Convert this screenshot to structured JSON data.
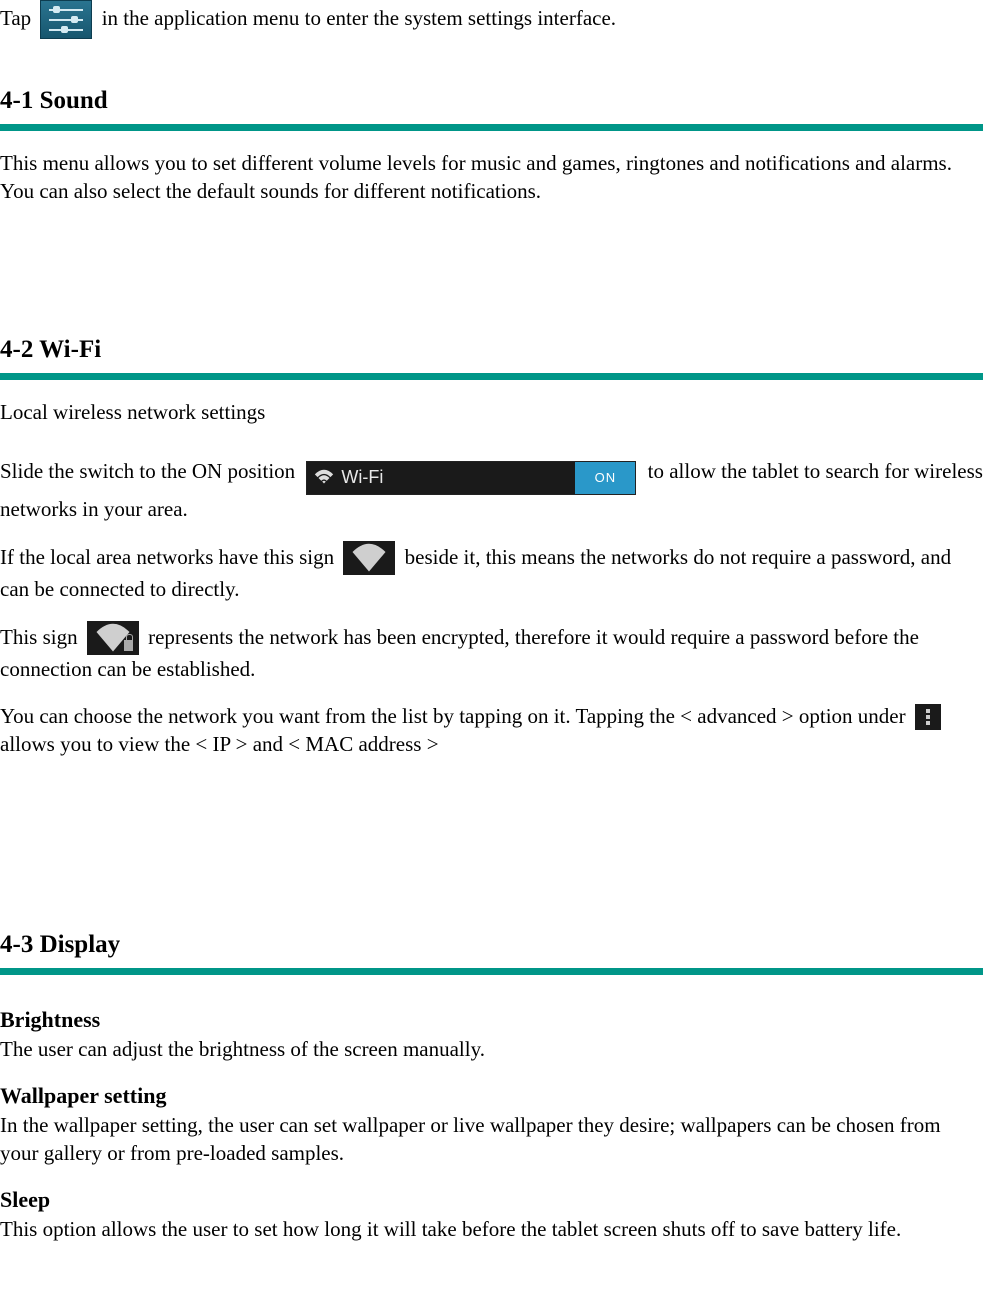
{
  "intro": {
    "before": "Tap",
    "after": "in the application menu to enter the system settings interface."
  },
  "sound": {
    "heading": "4-1 Sound",
    "body": "This menu allows you to set different volume levels for music and games, ringtones and notifications and alarms.    You can also select the default sounds for different notifications."
  },
  "wifi": {
    "heading": "4-2 Wi-Fi",
    "subtitle": "Local wireless network settings",
    "switch_label": "Wi-Fi",
    "switch_state": "ON",
    "p2_before": "Slide the switch to the ON position",
    "p2_after": "to allow the tablet to search for wireless networks in your area.",
    "p3_before": "If the local area networks have this sign",
    "p3_after": "beside it, this means the networks do not require a password, and can be connected to directly.",
    "p4_before": "This sign",
    "p4_after": "represents the network has been encrypted, therefore it would require a password before the connection can be established.",
    "p5_before": "You can choose the network you want from the list by tapping on it. Tapping the < advanced > option under",
    "p5_after": "allows you to view the < IP > and < MAC address >"
  },
  "display": {
    "heading": "4-3 Display",
    "brightness": {
      "title": "Brightness",
      "body": "The user can adjust the brightness of the screen manually."
    },
    "wallpaper": {
      "title": "Wallpaper setting",
      "body": "In the wallpaper setting, the user can set wallpaper or live wallpaper they desire; wallpapers can be chosen from your gallery or from pre-loaded samples."
    },
    "sleep": {
      "title": "Sleep",
      "body": "This option allows the user to set how long it will take before the tablet screen shuts off to save battery life."
    }
  }
}
